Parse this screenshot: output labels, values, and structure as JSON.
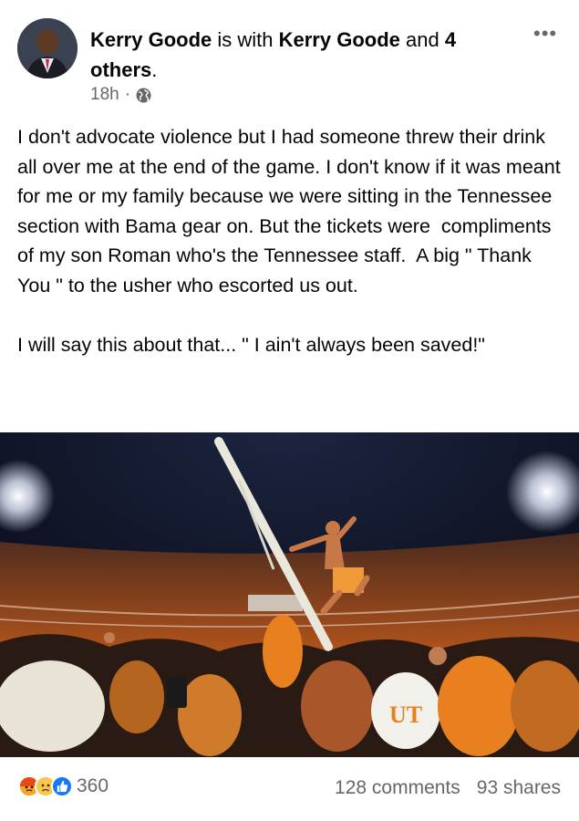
{
  "post": {
    "author": "Kerry Goode",
    "with_text": " is with ",
    "tagged": "Kerry Goode",
    "and_text": " and ",
    "others": "4 others",
    "others_end": ".",
    "time": "18h",
    "separator": "·",
    "privacy_icon": "globe-icon",
    "text": "I don't advocate violence but I had someone threw their drink all over me at the end of the game. I don't know if it was meant for me or my family because we were sitting in the Tennessee section with Bama gear on. But the tickets were  compliments of my son Roman who's the Tennessee staff.  A big \" Thank You \" to the usher who escorted us out.\n\nI will say this about that... \" I ain't always been saved!\""
  },
  "photo": {
    "logo_text": "UT"
  },
  "footer": {
    "reaction_icons": [
      "angry-icon",
      "sad-icon",
      "like-icon"
    ],
    "reaction_count": "360",
    "comments": "128 comments",
    "shares": "93 shares"
  },
  "colors": {
    "meta_gray": "#65676b",
    "like_blue": "#1877f2",
    "orange": "#e8801f"
  }
}
